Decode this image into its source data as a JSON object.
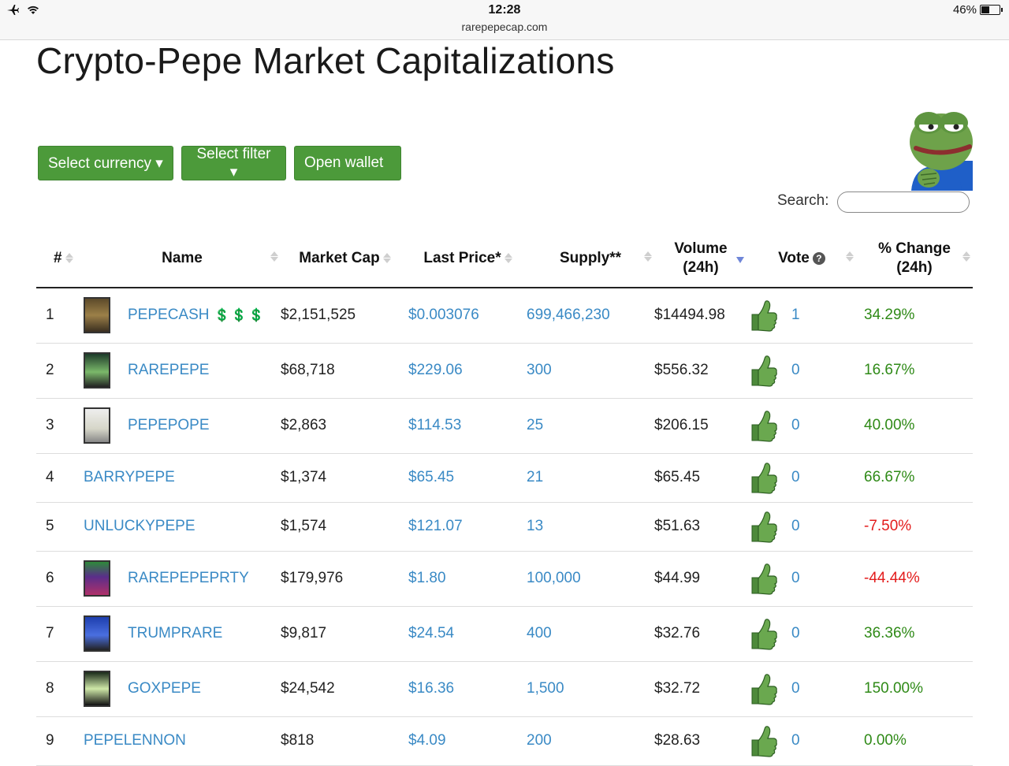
{
  "statusbar": {
    "time": "12:28",
    "url": "rarepepecap.com",
    "battery": "46%",
    "battery_level": 0.46
  },
  "page": {
    "title": "Crypto-Pepe Market Capitalizations"
  },
  "toolbar": {
    "currency": "Select currency ▾",
    "filter": "Select filter ▾",
    "wallet": "Open wallet"
  },
  "search": {
    "label": "Search:",
    "value": ""
  },
  "table": {
    "headers": {
      "rank": "#",
      "name": "Name",
      "market_cap": "Market Cap",
      "last_price": "Last Price*",
      "supply": "Supply**",
      "volume_1": "Volume",
      "volume_2": "(24h)",
      "vote": "Vote",
      "change_1": "% Change",
      "change_2": "(24h)"
    },
    "rows": [
      {
        "rank": "1",
        "name": "PEPECASH",
        "badge": "💲💲💲",
        "market_cap": "$2,151,525",
        "price": "$0.003076",
        "supply": "699,466,230",
        "volume": "$14494.98",
        "votes": "1",
        "change": "34.29%"
      },
      {
        "rank": "2",
        "name": "RAREPEPE",
        "market_cap": "$68,718",
        "price": "$229.06",
        "supply": "300",
        "volume": "$556.32",
        "votes": "0",
        "change": "16.67%"
      },
      {
        "rank": "3",
        "name": "PEPEPOPE",
        "market_cap": "$2,863",
        "price": "$114.53",
        "supply": "25",
        "volume": "$206.15",
        "votes": "0",
        "change": "40.00%"
      },
      {
        "rank": "4",
        "name": "BARRYPEPE",
        "market_cap": "$1,374",
        "price": "$65.45",
        "supply": "21",
        "volume": "$65.45",
        "votes": "0",
        "change": "66.67%"
      },
      {
        "rank": "5",
        "name": "UNLUCKYPEPE",
        "market_cap": "$1,574",
        "price": "$121.07",
        "supply": "13",
        "volume": "$51.63",
        "votes": "0",
        "change": "-7.50%"
      },
      {
        "rank": "6",
        "name": "RAREPEPEPRTY",
        "market_cap": "$179,976",
        "price": "$1.80",
        "supply": "100,000",
        "volume": "$44.99",
        "votes": "0",
        "change": "-44.44%"
      },
      {
        "rank": "7",
        "name": "TRUMPRARE",
        "market_cap": "$9,817",
        "price": "$24.54",
        "supply": "400",
        "volume": "$32.76",
        "votes": "0",
        "change": "36.36%"
      },
      {
        "rank": "8",
        "name": "GOXPEPE",
        "market_cap": "$24,542",
        "price": "$16.36",
        "supply": "1,500",
        "volume": "$32.72",
        "votes": "0",
        "change": "150.00%"
      },
      {
        "rank": "9",
        "name": "PEPELENNON",
        "market_cap": "$818",
        "price": "$4.09",
        "supply": "200",
        "volume": "$28.63",
        "votes": "0",
        "change": "0.00%"
      }
    ]
  },
  "colors": {
    "accent": "#4c9a3a",
    "link": "#3a8ac5",
    "positive": "#2f8a17",
    "negative": "#e31c1c"
  }
}
